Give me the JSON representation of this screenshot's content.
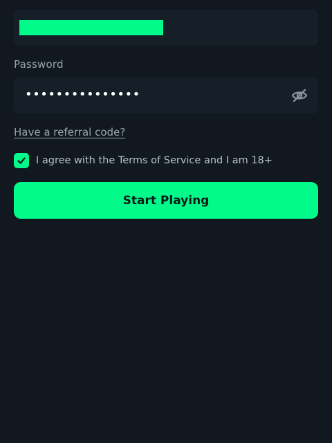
{
  "colors": {
    "background": "#111820",
    "field": "#161e27",
    "accent": "#00fb8a",
    "muted_text": "#9aa3ad"
  },
  "email": {
    "value_redacted": true
  },
  "password": {
    "label": "Password",
    "masked_value": "•••••••••••••••",
    "toggle_icon": "eye-off-icon"
  },
  "referral": {
    "link_text": "Have a referral code?"
  },
  "agreement": {
    "checked": true,
    "text": "I agree with the Terms of Service and I am 18+"
  },
  "cta": {
    "label": "Start Playing"
  }
}
